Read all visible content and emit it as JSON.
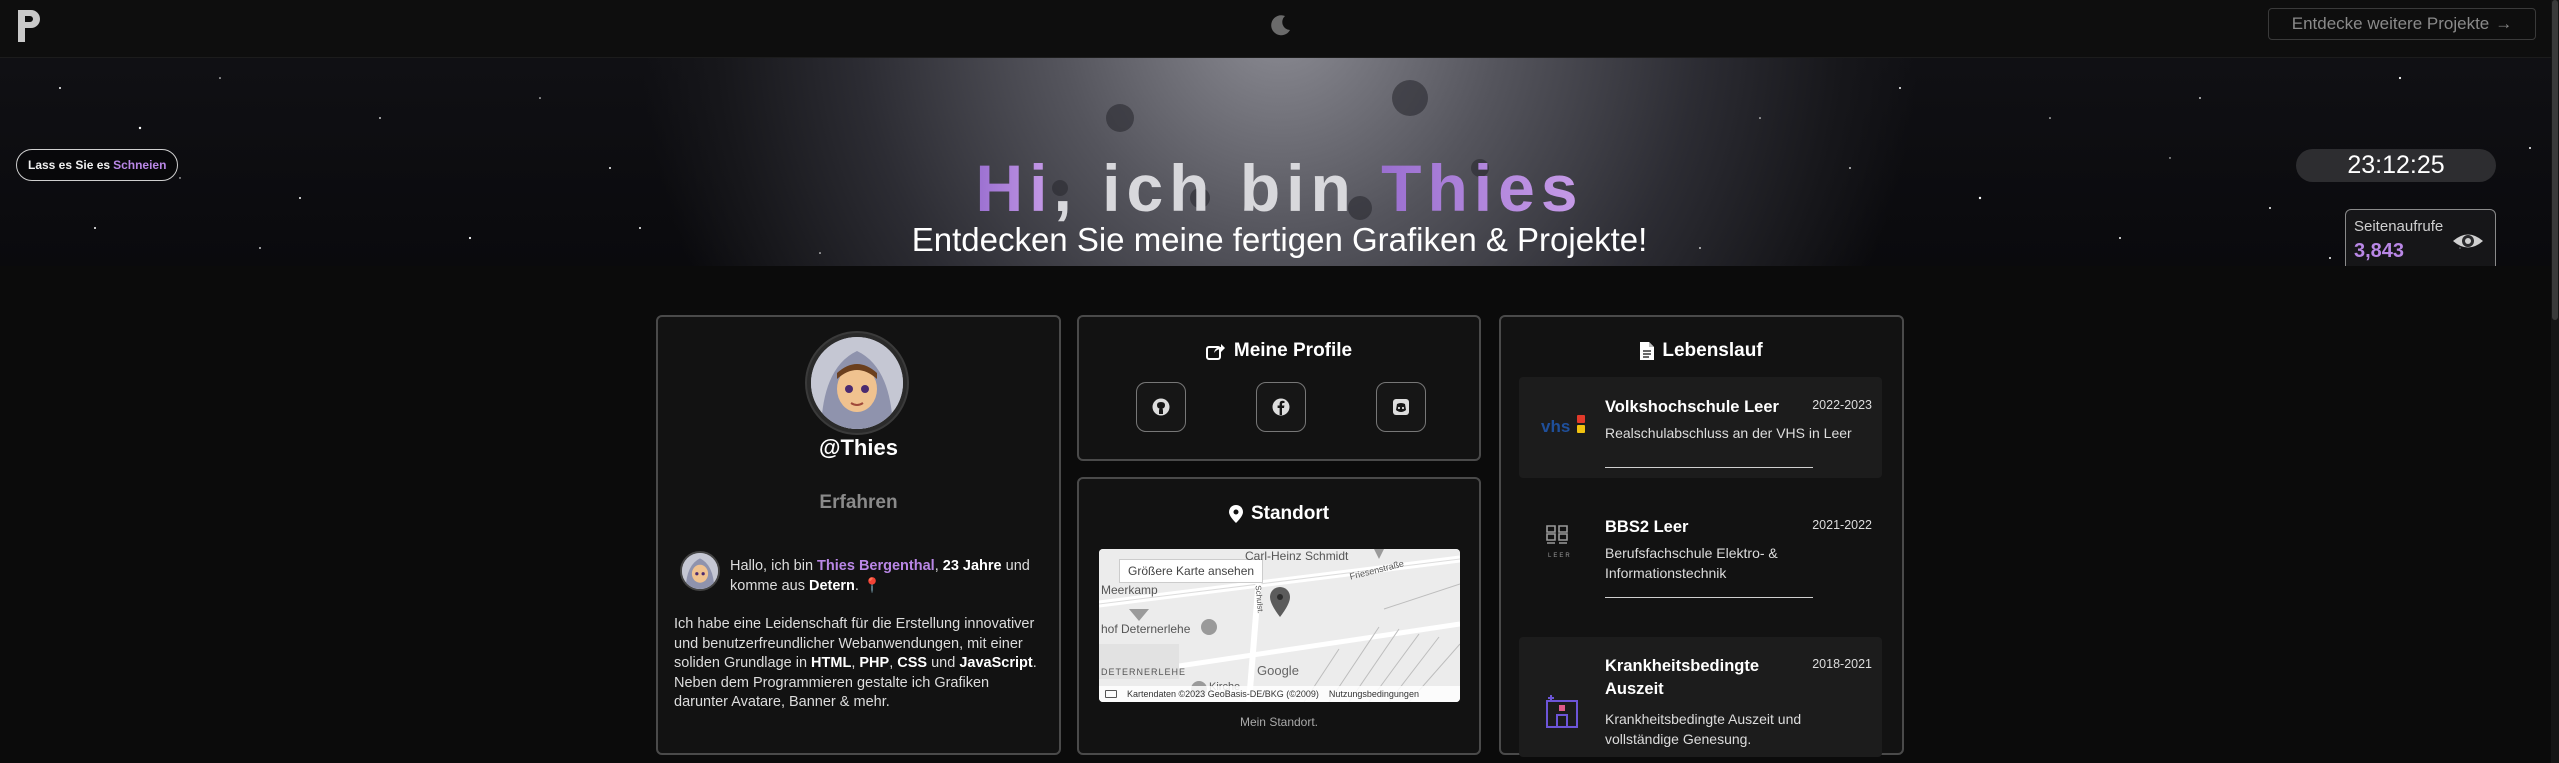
{
  "topbar": {
    "logo_icon": "p-logo-icon",
    "theme_icon": "moon-icon",
    "explore_label": "Entdecke weitere Projekte",
    "explore_arrow": "→"
  },
  "hero": {
    "snow_prefix": "Lass es Sie es",
    "snow_accent": "Schneien",
    "title_hi": "Hi",
    "title_mid": ", ich bin",
    "title_name": "Thies",
    "subtitle": "Entdecken Sie meine fertigen Grafiken & Projekte!",
    "clock": "23:12:25",
    "views_label": "Seitenaufrufe",
    "views_count": "3,843",
    "views_icon": "eye-icon"
  },
  "profile": {
    "handle": "@Thies",
    "rank": "Erfahren",
    "intro_1": "Hallo, ich bin ",
    "intro_name": "Thies Bergenthal",
    "intro_2": ", ",
    "intro_age": "23 Jahre",
    "intro_3": " und komme aus ",
    "intro_city": "Detern",
    "intro_4": ". 📍",
    "about_1": "Ich habe eine Leidenschaft für die Erstellung innovativer und benutzerfreundlicher Webanwendungen, mit einer soliden Grundlage in ",
    "about_html": "HTML",
    "about_sep1": ", ",
    "about_php": "PHP",
    "about_sep2": ", ",
    "about_css": "CSS",
    "about_und": " und ",
    "about_js": "JavaScript",
    "about_2": ". Neben dem Programmieren gestalte ich Grafiken darunter Avatare, Banner & mehr."
  },
  "profiles": {
    "title": "Meine Profile",
    "title_icon": "share-icon",
    "links": [
      {
        "icon": "github-icon"
      },
      {
        "icon": "facebook-icon"
      },
      {
        "icon": "discord-icon"
      }
    ]
  },
  "location": {
    "title": "Standort",
    "title_icon": "map-pin-icon",
    "map_button": "Größere Karte ansehen",
    "labels": {
      "schmidt": "Carl-Heinz Schmidt",
      "meerkamp": "Meerkamp",
      "friesen": "Friesenstraße",
      "hof": "hof Deternerlehe",
      "schulst": "Schulst.",
      "deternerlehe": "DETERNERLEHE",
      "kirche": "Kirche"
    },
    "google": "Google",
    "footer_data": "Kartendaten ©2023 GeoBasis-DE/BKG (©2009)",
    "footer_terms": "Nutzungsbedingungen",
    "caption": "Mein Standort."
  },
  "cv": {
    "title": "Lebenslauf",
    "title_icon": "document-icon",
    "items": [
      {
        "name": "Volkshochschule Leer",
        "years": "2022-2023",
        "desc": "Realschulabschluss an der VHS in Leer",
        "logo_text": "vhs"
      },
      {
        "name": "BBS2 Leer",
        "years": "2021-2022",
        "desc": "Berufsfachschule Elektro- & Informationstechnik",
        "logo_text": "LEER"
      },
      {
        "name": "Krankheitsbedingte Auszeit",
        "years": "2018-2021",
        "desc": "Krankheitsbedingte Auszeit und vollständige Genesung."
      }
    ]
  },
  "colors": {
    "accent": "#b987e6",
    "background": "#0b0b0b"
  }
}
